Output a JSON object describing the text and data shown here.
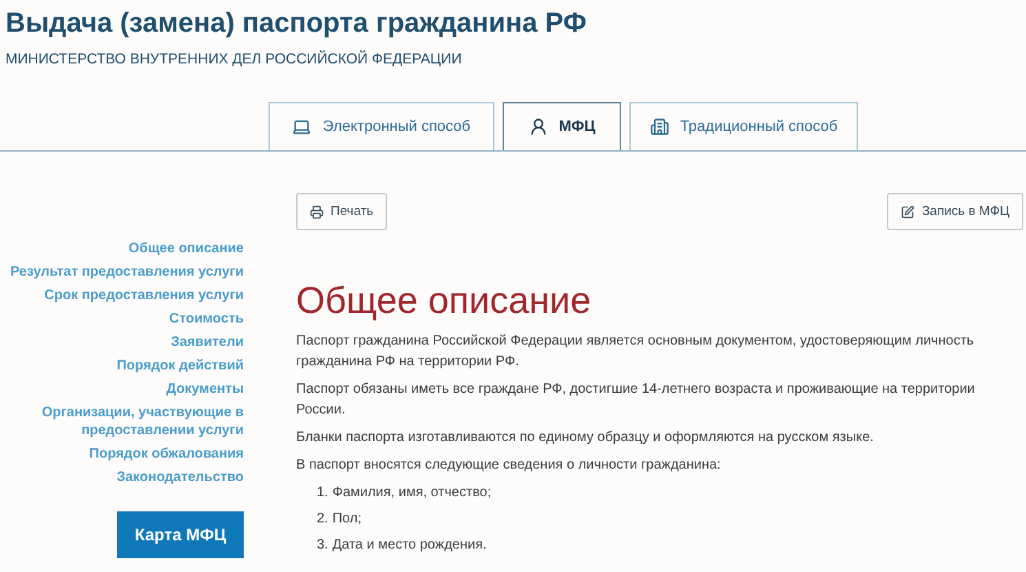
{
  "header": {
    "title": "Выдача (замена) паспорта гражданина РФ",
    "subtitle": "МИНИСТЕРСТВО ВНУТРЕННИХ ДЕЛ РОССИЙСКОЙ ФЕДЕРАЦИИ"
  },
  "tabs": [
    {
      "label": "Электронный способ",
      "kind": "laptop",
      "selected": false
    },
    {
      "label": "МФЦ",
      "kind": "person",
      "selected": true
    },
    {
      "label": "Традиционный способ",
      "kind": "building",
      "selected": false
    }
  ],
  "sidebar": {
    "items": [
      {
        "label": "Общее описание"
      },
      {
        "label": "Результат предоставления услуги"
      },
      {
        "label": "Срок предоставления услуги"
      },
      {
        "label": "Стоимость"
      },
      {
        "label": "Заявители"
      },
      {
        "label": "Порядок действий"
      },
      {
        "label": "Документы"
      },
      {
        "label": "Организации, участвующие в предоставлении услуги"
      },
      {
        "label": "Порядок обжалования"
      },
      {
        "label": "Законодательство"
      }
    ],
    "map_button": "Карта МФЦ"
  },
  "toolbar": {
    "print_button": "Печать",
    "appointment_button": "Запись в МФЦ"
  },
  "content": {
    "heading": "Общее описание",
    "paragraphs": [
      "Паспорт гражданина Российской Федерации является основным документом, удостоверяющим личность гражданина РФ на территории РФ.",
      "Паспорт обязаны иметь все граждане РФ, достигшие 14-летнего возраста и проживающие на территории России.",
      "Бланки паспорта изготавливаются по единому образцу и оформляются на русском языке.",
      "В паспорт вносятся следующие сведения о личности гражданина:"
    ],
    "list": [
      {
        "number": "1.",
        "text": "Фамилия, имя, отчество;"
      },
      {
        "number": "2.",
        "text": "Пол;"
      },
      {
        "number": "3.",
        "text": "Дата и место рождения."
      }
    ]
  }
}
